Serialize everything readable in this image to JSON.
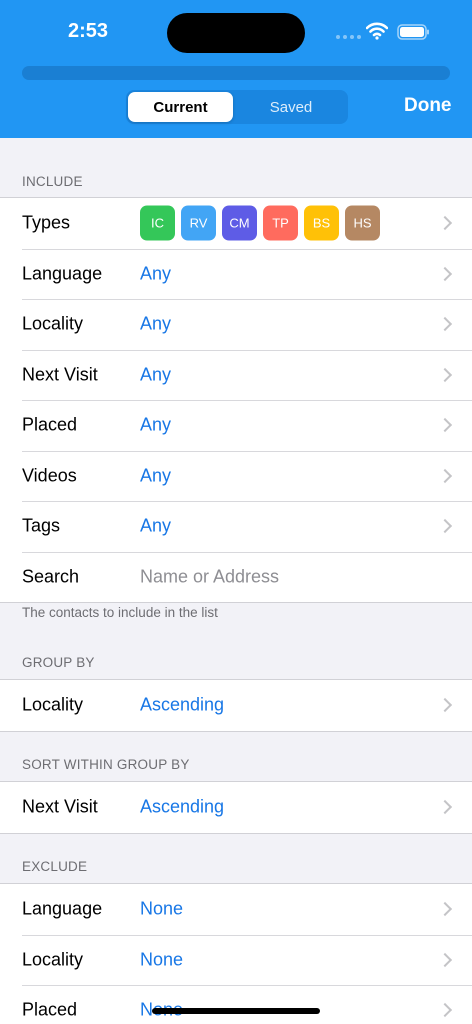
{
  "status_bar": {
    "time": "2:53"
  },
  "nav": {
    "segments": [
      "Current",
      "Saved"
    ],
    "selected": "Current",
    "done_label": "Done"
  },
  "colors": {
    "header": "#2196f3",
    "accent": "#1877e6",
    "types": {
      "IC": "#34c759",
      "RV": "#42a5f5",
      "CM": "#5e5ce6",
      "TP": "#ff6b5e",
      "BS": "#ffc107",
      "HS": "#b58863"
    }
  },
  "include": {
    "header": "INCLUDE",
    "footer": "The contacts to include in the list",
    "types_label": "Types",
    "types": [
      "IC",
      "RV",
      "CM",
      "TP",
      "BS",
      "HS"
    ],
    "rows": [
      {
        "label": "Language",
        "value": "Any"
      },
      {
        "label": "Locality",
        "value": "Any"
      },
      {
        "label": "Next Visit",
        "value": "Any"
      },
      {
        "label": "Placed",
        "value": "Any"
      },
      {
        "label": "Videos",
        "value": "Any"
      },
      {
        "label": "Tags",
        "value": "Any"
      }
    ],
    "search": {
      "label": "Search",
      "placeholder": "Name or Address"
    }
  },
  "group_by": {
    "header": "GROUP BY",
    "rows": [
      {
        "label": "Locality",
        "value": "Ascending"
      }
    ]
  },
  "sort_within": {
    "header": "SORT WITHIN GROUP BY",
    "rows": [
      {
        "label": "Next Visit",
        "value": "Ascending"
      }
    ]
  },
  "exclude": {
    "header": "EXCLUDE",
    "rows": [
      {
        "label": "Language",
        "value": "None"
      },
      {
        "label": "Locality",
        "value": "None"
      },
      {
        "label": "Placed",
        "value": "None"
      }
    ]
  }
}
